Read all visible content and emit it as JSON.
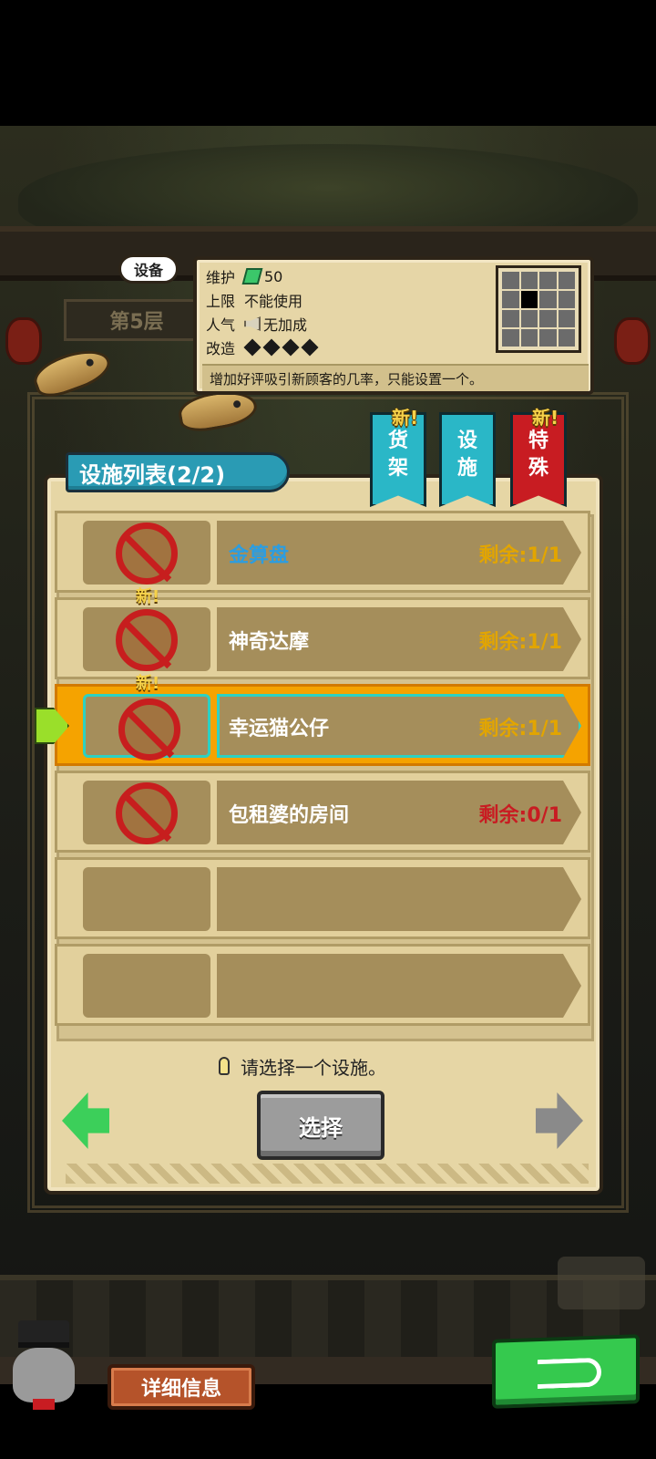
{
  "scene": {
    "floor_label": "第5层"
  },
  "info": {
    "tag": "设备",
    "maintenance_label": "维护",
    "maintenance_value": "50",
    "limit_label": "上限",
    "limit_value": "不能使用",
    "popularity_label": "人气",
    "popularity_value": "无加成",
    "upgrade_label": "改造",
    "upgrade_level": 4,
    "description": "增加好评吸引新顾客的几率，只能设置一个。"
  },
  "panel": {
    "title": "设施列表(2/2)",
    "tabs": [
      {
        "top": "货",
        "bottom": "架",
        "new": "新!"
      },
      {
        "top": "设",
        "bottom": "施",
        "new": ""
      },
      {
        "top": "特",
        "bottom": "殊",
        "new": "新!"
      }
    ],
    "items": [
      {
        "name": "金算盘",
        "remaining": "剩余:1/1",
        "new": ""
      },
      {
        "name": "神奇达摩",
        "remaining": "剩余:1/1",
        "new": "新!"
      },
      {
        "name": "幸运猫公仔",
        "remaining": "剩余:1/1",
        "new": "新!"
      },
      {
        "name": "包租婆的房间",
        "remaining": "剩余:0/1",
        "new": ""
      }
    ],
    "hint": "请选择一个设施。",
    "select_label": "选择"
  },
  "footer": {
    "detail_label": "详细信息"
  },
  "colors": {
    "remaining_ok": "#e2a500",
    "remaining_out": "#c81c22",
    "name": "#2c9de0",
    "name_alt": "#ffffff",
    "accent_selected": "#f5a300"
  }
}
